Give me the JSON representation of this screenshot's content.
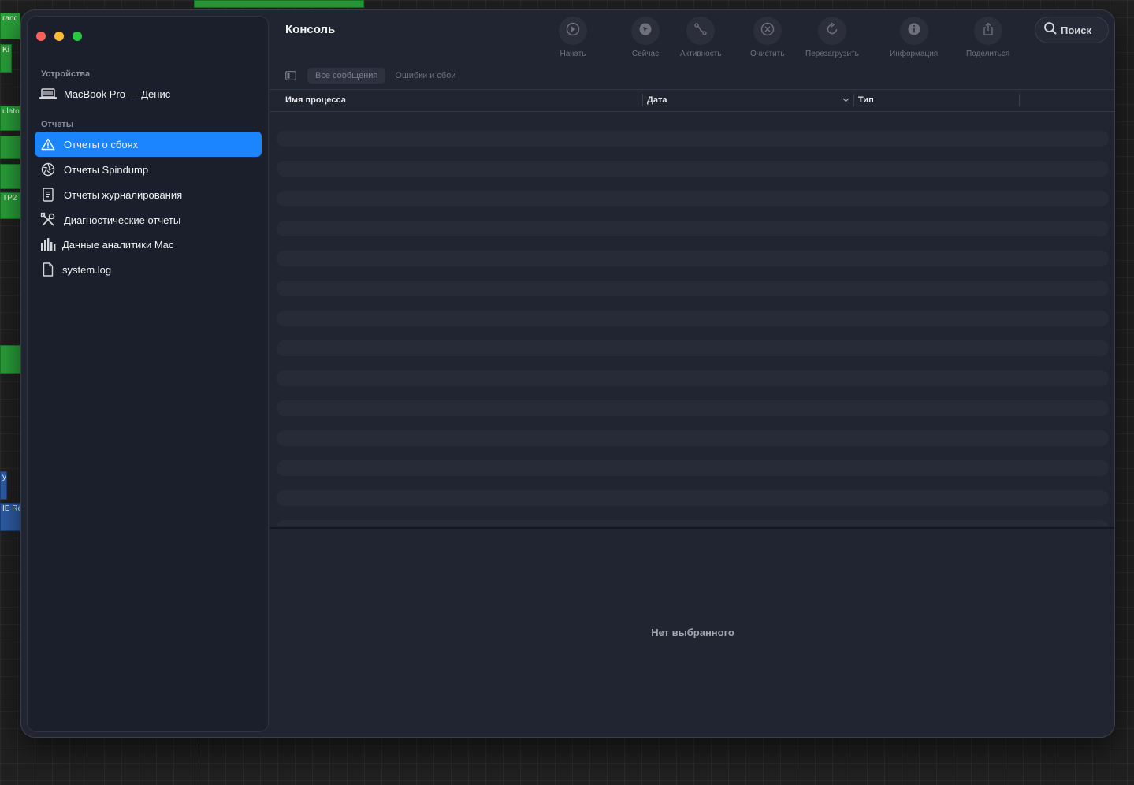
{
  "window": {
    "title": "Консоль"
  },
  "sidebar": {
    "devices_label": "Устройства",
    "device_name": "MacBook Pro — Денис",
    "reports_label": "Отчеты",
    "items": [
      {
        "label": "Отчеты о сбоях",
        "icon": "warning-icon",
        "selected": true
      },
      {
        "label": "Отчеты Spindump",
        "icon": "aperture-icon"
      },
      {
        "label": "Отчеты журналирования",
        "icon": "document-lines-icon"
      },
      {
        "label": "Диагностические отчеты",
        "icon": "tools-icon"
      },
      {
        "label": "Данные аналитики Mac",
        "icon": "bar-chart-icon"
      },
      {
        "label": "system.log",
        "icon": "file-icon"
      }
    ]
  },
  "toolbar": {
    "start": "Начать",
    "now": "Сейчас",
    "activity": "Активность",
    "clear": "Очистить",
    "reload": "Перезагрузить",
    "info": "Информация",
    "share": "Поделиться",
    "search": "Поиск"
  },
  "filters": {
    "all": "Все сообщения",
    "errors": "Ошибки и сбои"
  },
  "table": {
    "col_process": "Имя процесса",
    "col_date": "Дата",
    "col_type": "Тип"
  },
  "detail": {
    "empty": "Нет выбранного"
  },
  "background": {
    "clips": [
      "ranc",
      "Ki",
      "ulato",
      "TP2 :",
      "y",
      "IE Re"
    ]
  },
  "colors": {
    "accent": "#1b85ff",
    "window_bg": "#212431",
    "sidebar_bg": "#1b1f2b",
    "close": "#fe5f57",
    "minimize": "#febc2e",
    "zoom": "#28c840"
  }
}
